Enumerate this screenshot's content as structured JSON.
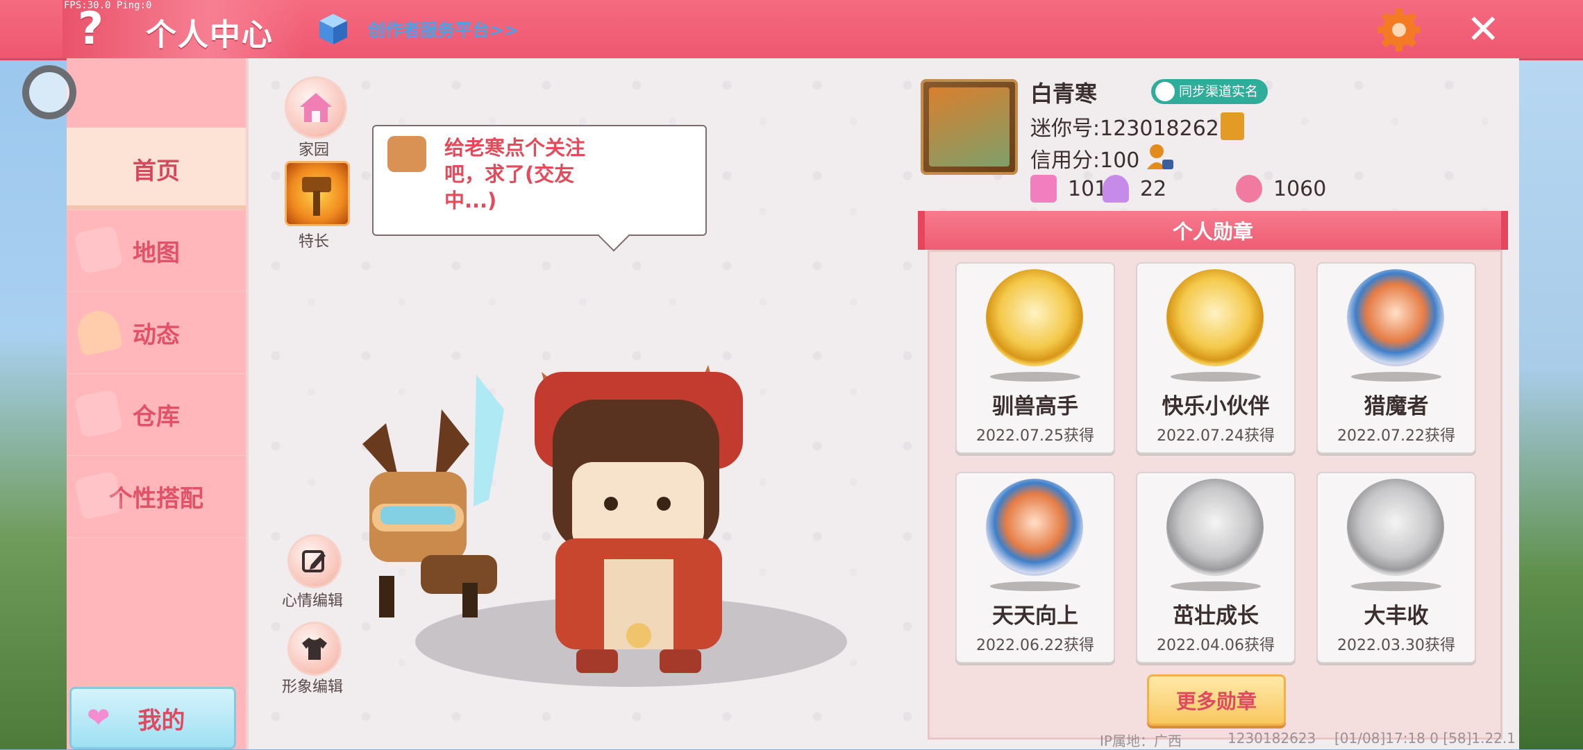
{
  "top": {
    "fps": "FPS:30.0  Ping:0",
    "help": "?",
    "title": "个人中心",
    "creator_link": "创作者服务平台>>"
  },
  "sidebar": {
    "items": [
      {
        "label": "首页"
      },
      {
        "label": "地图"
      },
      {
        "label": "动态"
      },
      {
        "label": "仓库"
      },
      {
        "label": "个性搭配"
      }
    ],
    "my_button": "我的"
  },
  "tools": {
    "home": "家园",
    "specialty": "特长",
    "mood_edit": "心情编辑",
    "image_edit": "形象编辑"
  },
  "bubble": {
    "text": "给老寒点个关注吧，求了(交友中...)"
  },
  "profile": {
    "name": "白青寒",
    "realname_badge": "同步渠道实名",
    "mini_id": "迷你号:1230182623",
    "credit": "信用分:100",
    "stats": {
      "likes": "101",
      "fans": "22",
      "popularity": "1060"
    }
  },
  "medals": {
    "header": "个人勋章",
    "items": [
      {
        "name": "驯兽高手",
        "date": "2022.07.25获得",
        "style": "gold"
      },
      {
        "name": "快乐小伙伴",
        "date": "2022.07.24获得",
        "style": "gold"
      },
      {
        "name": "猎魔者",
        "date": "2022.07.22获得",
        "style": "blue"
      },
      {
        "name": "天天向上",
        "date": "2022.06.22获得",
        "style": "blue"
      },
      {
        "name": "茁壮成长",
        "date": "2022.04.06获得",
        "style": "silver"
      },
      {
        "name": "大丰收",
        "date": "2022.03.30获得",
        "style": "silver"
      }
    ],
    "more_button": "更多勋章"
  },
  "footer": {
    "ip": "IP属地：广西",
    "uid": "1230182623",
    "version": "[01/08]17:18 0   [58]1.22.1"
  },
  "colors": {
    "primary": "#ee5770",
    "sidebar": "#ffb7bc",
    "accent_text": "#e04a60",
    "link": "#4aa2e8"
  }
}
